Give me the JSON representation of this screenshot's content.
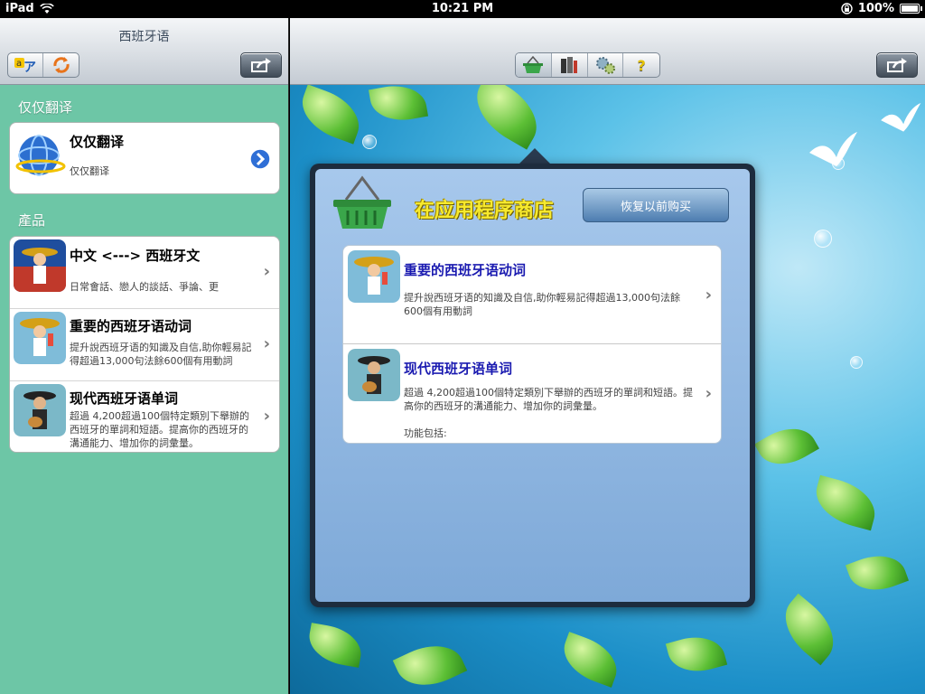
{
  "status_bar": {
    "device": "iPad",
    "time": "10:21 PM",
    "battery": "100%"
  },
  "left_panel": {
    "title": "西班牙语",
    "section_translate": {
      "header": "仅仅翻译",
      "item": {
        "title": "仅仅翻译",
        "subtitle": "仅仅翻译"
      }
    },
    "section_products": {
      "header": "產品",
      "items": [
        {
          "title": "中文 <---> 西班牙文",
          "subtitle": "日常會話、戀人的談話、爭論、更"
        },
        {
          "title": "重要的西班牙语动词",
          "subtitle": "提升說西班牙语的知識及自信,助你輕易記得超過13,000句法餘600個有用動詞"
        },
        {
          "title": "现代西班牙语单词",
          "subtitle": "超過 4,200超過100個特定類別下舉辦的西班牙的單詞和短語。提高你的西班牙的溝通能力、增加你的詞彙量。"
        }
      ]
    }
  },
  "toolbar": {
    "icons": [
      "basket-icon",
      "books-icon",
      "gears-icon",
      "help-icon"
    ],
    "help_label": "?"
  },
  "store": {
    "title": "在应用程序商店",
    "restore_label": "恢复以前购买",
    "items": [
      {
        "title": "重要的西班牙语动词",
        "desc": "提升說西班牙语的知識及自信,助你輕易記得超過13,000句法餘600個有用動詞"
      },
      {
        "title": "现代西班牙语单词",
        "desc": "超過 4,200超過100個特定類別下舉辦的西班牙的單詞和短語。提高你的西班牙的溝通能力、增加你的詞彙量。",
        "extra": "功能包括:"
      }
    ]
  },
  "colors": {
    "left_bg": "#6dc6a6",
    "store_title": "#f7ea2e",
    "item_title": "#1a1ab0",
    "popover_bg": "#a7c8ec"
  }
}
